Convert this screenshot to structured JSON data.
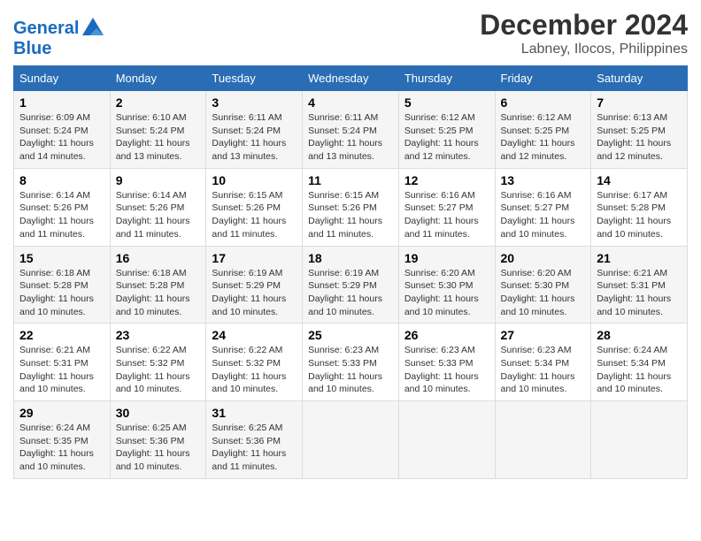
{
  "header": {
    "logo_line1": "General",
    "logo_line2": "Blue",
    "month_year": "December 2024",
    "location": "Labney, Ilocos, Philippines"
  },
  "weekdays": [
    "Sunday",
    "Monday",
    "Tuesday",
    "Wednesday",
    "Thursday",
    "Friday",
    "Saturday"
  ],
  "weeks": [
    [
      {
        "day": "1",
        "rise": "Sunrise: 6:09 AM",
        "set": "Sunset: 5:24 PM",
        "daylight": "Daylight: 11 hours",
        "minutes": "and 14 minutes."
      },
      {
        "day": "2",
        "rise": "Sunrise: 6:10 AM",
        "set": "Sunset: 5:24 PM",
        "daylight": "Daylight: 11 hours",
        "minutes": "and 13 minutes."
      },
      {
        "day": "3",
        "rise": "Sunrise: 6:11 AM",
        "set": "Sunset: 5:24 PM",
        "daylight": "Daylight: 11 hours",
        "minutes": "and 13 minutes."
      },
      {
        "day": "4",
        "rise": "Sunrise: 6:11 AM",
        "set": "Sunset: 5:24 PM",
        "daylight": "Daylight: 11 hours",
        "minutes": "and 13 minutes."
      },
      {
        "day": "5",
        "rise": "Sunrise: 6:12 AM",
        "set": "Sunset: 5:25 PM",
        "daylight": "Daylight: 11 hours",
        "minutes": "and 12 minutes."
      },
      {
        "day": "6",
        "rise": "Sunrise: 6:12 AM",
        "set": "Sunset: 5:25 PM",
        "daylight": "Daylight: 11 hours",
        "minutes": "and 12 minutes."
      },
      {
        "day": "7",
        "rise": "Sunrise: 6:13 AM",
        "set": "Sunset: 5:25 PM",
        "daylight": "Daylight: 11 hours",
        "minutes": "and 12 minutes."
      }
    ],
    [
      {
        "day": "8",
        "rise": "Sunrise: 6:14 AM",
        "set": "Sunset: 5:26 PM",
        "daylight": "Daylight: 11 hours",
        "minutes": "and 11 minutes."
      },
      {
        "day": "9",
        "rise": "Sunrise: 6:14 AM",
        "set": "Sunset: 5:26 PM",
        "daylight": "Daylight: 11 hours",
        "minutes": "and 11 minutes."
      },
      {
        "day": "10",
        "rise": "Sunrise: 6:15 AM",
        "set": "Sunset: 5:26 PM",
        "daylight": "Daylight: 11 hours",
        "minutes": "and 11 minutes."
      },
      {
        "day": "11",
        "rise": "Sunrise: 6:15 AM",
        "set": "Sunset: 5:26 PM",
        "daylight": "Daylight: 11 hours",
        "minutes": "and 11 minutes."
      },
      {
        "day": "12",
        "rise": "Sunrise: 6:16 AM",
        "set": "Sunset: 5:27 PM",
        "daylight": "Daylight: 11 hours",
        "minutes": "and 11 minutes."
      },
      {
        "day": "13",
        "rise": "Sunrise: 6:16 AM",
        "set": "Sunset: 5:27 PM",
        "daylight": "Daylight: 11 hours",
        "minutes": "and 10 minutes."
      },
      {
        "day": "14",
        "rise": "Sunrise: 6:17 AM",
        "set": "Sunset: 5:28 PM",
        "daylight": "Daylight: 11 hours",
        "minutes": "and 10 minutes."
      }
    ],
    [
      {
        "day": "15",
        "rise": "Sunrise: 6:18 AM",
        "set": "Sunset: 5:28 PM",
        "daylight": "Daylight: 11 hours",
        "minutes": "and 10 minutes."
      },
      {
        "day": "16",
        "rise": "Sunrise: 6:18 AM",
        "set": "Sunset: 5:28 PM",
        "daylight": "Daylight: 11 hours",
        "minutes": "and 10 minutes."
      },
      {
        "day": "17",
        "rise": "Sunrise: 6:19 AM",
        "set": "Sunset: 5:29 PM",
        "daylight": "Daylight: 11 hours",
        "minutes": "and 10 minutes."
      },
      {
        "day": "18",
        "rise": "Sunrise: 6:19 AM",
        "set": "Sunset: 5:29 PM",
        "daylight": "Daylight: 11 hours",
        "minutes": "and 10 minutes."
      },
      {
        "day": "19",
        "rise": "Sunrise: 6:20 AM",
        "set": "Sunset: 5:30 PM",
        "daylight": "Daylight: 11 hours",
        "minutes": "and 10 minutes."
      },
      {
        "day": "20",
        "rise": "Sunrise: 6:20 AM",
        "set": "Sunset: 5:30 PM",
        "daylight": "Daylight: 11 hours",
        "minutes": "and 10 minutes."
      },
      {
        "day": "21",
        "rise": "Sunrise: 6:21 AM",
        "set": "Sunset: 5:31 PM",
        "daylight": "Daylight: 11 hours",
        "minutes": "and 10 minutes."
      }
    ],
    [
      {
        "day": "22",
        "rise": "Sunrise: 6:21 AM",
        "set": "Sunset: 5:31 PM",
        "daylight": "Daylight: 11 hours",
        "minutes": "and 10 minutes."
      },
      {
        "day": "23",
        "rise": "Sunrise: 6:22 AM",
        "set": "Sunset: 5:32 PM",
        "daylight": "Daylight: 11 hours",
        "minutes": "and 10 minutes."
      },
      {
        "day": "24",
        "rise": "Sunrise: 6:22 AM",
        "set": "Sunset: 5:32 PM",
        "daylight": "Daylight: 11 hours",
        "minutes": "and 10 minutes."
      },
      {
        "day": "25",
        "rise": "Sunrise: 6:23 AM",
        "set": "Sunset: 5:33 PM",
        "daylight": "Daylight: 11 hours",
        "minutes": "and 10 minutes."
      },
      {
        "day": "26",
        "rise": "Sunrise: 6:23 AM",
        "set": "Sunset: 5:33 PM",
        "daylight": "Daylight: 11 hours",
        "minutes": "and 10 minutes."
      },
      {
        "day": "27",
        "rise": "Sunrise: 6:23 AM",
        "set": "Sunset: 5:34 PM",
        "daylight": "Daylight: 11 hours",
        "minutes": "and 10 minutes."
      },
      {
        "day": "28",
        "rise": "Sunrise: 6:24 AM",
        "set": "Sunset: 5:34 PM",
        "daylight": "Daylight: 11 hours",
        "minutes": "and 10 minutes."
      }
    ],
    [
      {
        "day": "29",
        "rise": "Sunrise: 6:24 AM",
        "set": "Sunset: 5:35 PM",
        "daylight": "Daylight: 11 hours",
        "minutes": "and 10 minutes."
      },
      {
        "day": "30",
        "rise": "Sunrise: 6:25 AM",
        "set": "Sunset: 5:36 PM",
        "daylight": "Daylight: 11 hours",
        "minutes": "and 10 minutes."
      },
      {
        "day": "31",
        "rise": "Sunrise: 6:25 AM",
        "set": "Sunset: 5:36 PM",
        "daylight": "Daylight: 11 hours",
        "minutes": "and 11 minutes."
      },
      null,
      null,
      null,
      null
    ]
  ]
}
